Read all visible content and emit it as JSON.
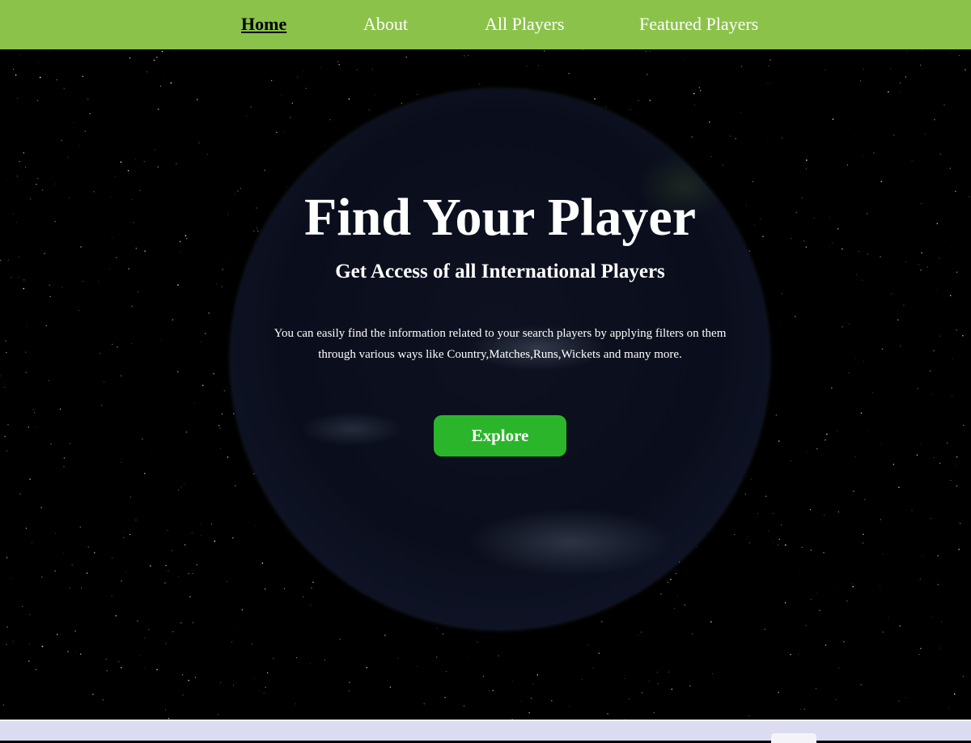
{
  "nav": {
    "items": [
      {
        "label": "Home",
        "active": true
      },
      {
        "label": "About",
        "active": false
      },
      {
        "label": "All Players",
        "active": false
      },
      {
        "label": "Featured Players",
        "active": false
      }
    ],
    "background": "#8bc34a"
  },
  "hero": {
    "title": "Find Your Player",
    "subtitle": "Get Access of all International Players",
    "description": "You can easily find the information related to your search players by applying filters on them through various ways like Country,Matches,Runs,Wickets and many more.",
    "button_label": "Explore",
    "button_color": "#2bb52b"
  }
}
